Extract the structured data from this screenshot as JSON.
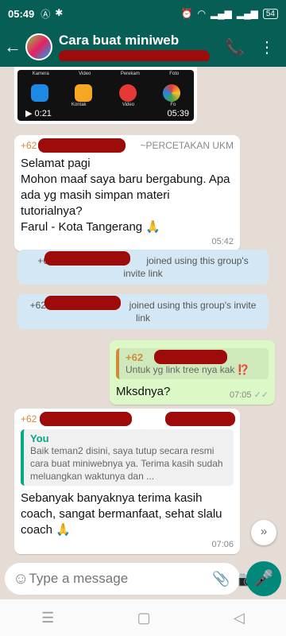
{
  "status_bar": {
    "time": "05:49",
    "battery": "54"
  },
  "app_bar": {
    "title": "Cara buat miniweb"
  },
  "video": {
    "labels": [
      "Kamera",
      "Video",
      "Perekam",
      "Foto"
    ],
    "sublabels": [
      "",
      "Kontak",
      "Video",
      "Fo"
    ],
    "duration": "0:21",
    "time": "05:39"
  },
  "messages": [
    {
      "phone": "+62",
      "source": "~PERCETAKAN UKM",
      "text": "Selamat pagi\nMohon maaf saya baru bergabung. Apa ada yg masih simpan materi tutorialnya?\nFarul - Kota Tangerang 🙏",
      "time": "05:42"
    }
  ],
  "system": [
    {
      "phone": "+62",
      "text": "joined using this group's invite link"
    },
    {
      "phone": "+62",
      "text": "joined using this group's invite link"
    }
  ],
  "out_msg": {
    "quote_author": "+62",
    "quote_text": "Untuk yg link tree nya kak ⁉️",
    "text": "Mksdnya?",
    "time": "07:05",
    "ticks": "✓✓"
  },
  "last_msg": {
    "phone": "+62",
    "quote_author": "You",
    "quote_text": "Baik teman2 disini, saya tutup secara resmi cara buat miniwebnya ya. Terima kasih sudah meluangkan waktunya dan ...",
    "text": "Sebanyak banyaknya terima kasih coach, sangat bermanfaat, sehat slalu coach 🙏",
    "time": "07:06"
  },
  "input": {
    "placeholder": "Type a message"
  },
  "icons": {
    "back": "arrow-left-icon",
    "call": "add-call-icon",
    "menu": "more-vert-icon",
    "emoji": "emoji-icon",
    "attach": "paperclip-icon",
    "camera": "camera-icon",
    "mic": "mic-icon",
    "scroll": "chevron-double-down-icon"
  },
  "colors": {
    "header": "#075e54",
    "outgoing": "#dcf8c6",
    "system": "#d3e8f4",
    "mic": "#00897b"
  }
}
